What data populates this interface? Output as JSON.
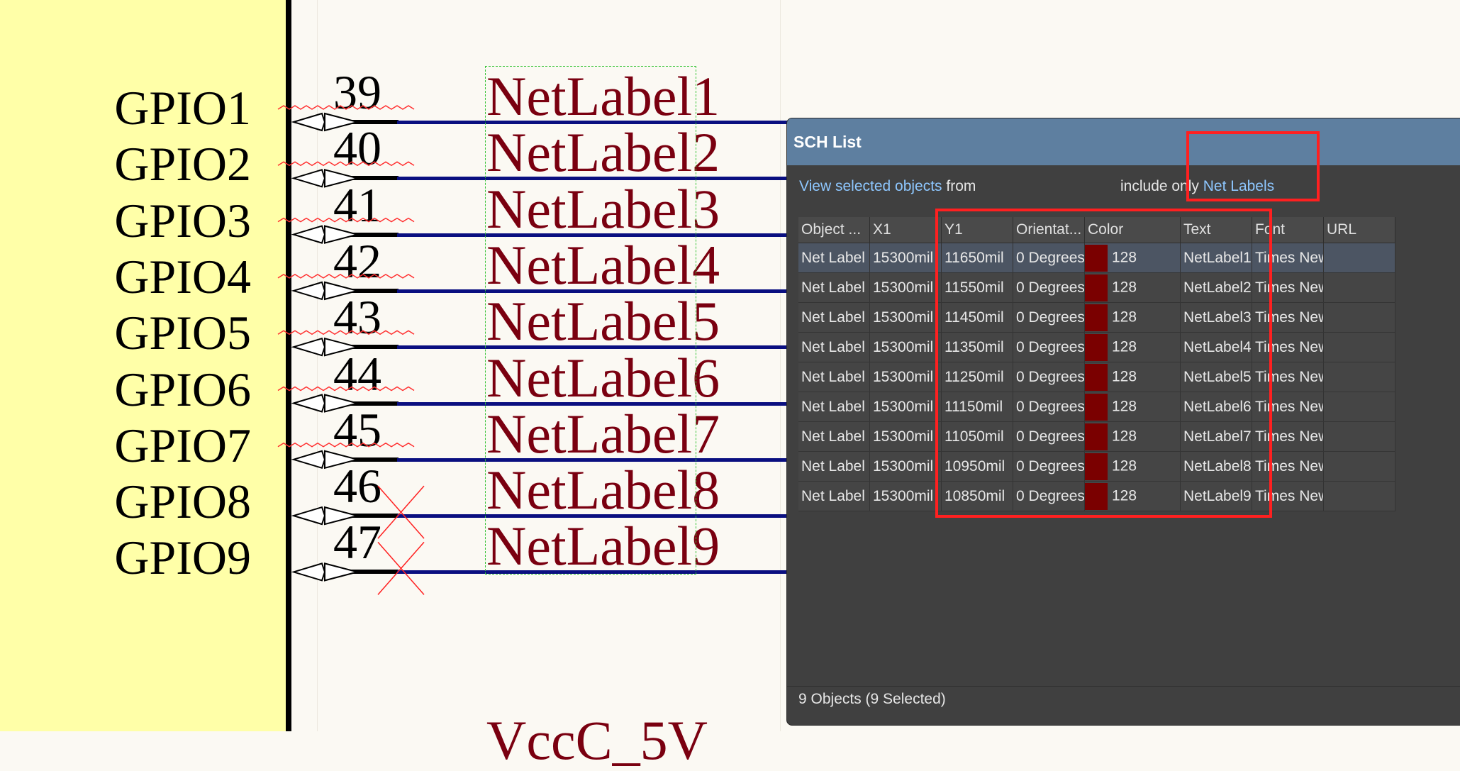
{
  "schematic": {
    "gpio_labels": [
      "GPIO1",
      "GPIO2",
      "GPIO3",
      "GPIO4",
      "GPIO5",
      "GPIO6",
      "GPIO7",
      "GPIO8",
      "GPIO9"
    ],
    "pin_numbers": [
      "39",
      "40",
      "41",
      "42",
      "43",
      "44",
      "45",
      "46",
      "47"
    ],
    "net_labels": [
      "NetLabel1",
      "NetLabel2",
      "NetLabel3",
      "NetLabel4",
      "NetLabel5",
      "NetLabel6",
      "NetLabel7",
      "NetLabel8",
      "NetLabel9"
    ],
    "bottom_text": "VccC_5V"
  },
  "panel": {
    "title": "SCH List",
    "view_link": "View selected objects",
    "from_text": "from",
    "include_text": "include only",
    "include_link": "Net Labels",
    "columns": [
      "Object ...",
      "X1",
      "Y1",
      "Orientat...",
      "Color",
      "Text",
      "Font",
      "URL"
    ],
    "rows": [
      {
        "type": "Net Label",
        "x1": "15300mil",
        "y1": "11650mil",
        "orient": "0 Degrees",
        "color_hex": "#7a0000",
        "color": "128",
        "text": "NetLabel1",
        "font": "Times New Roman",
        "url": ""
      },
      {
        "type": "Net Label",
        "x1": "15300mil",
        "y1": "11550mil",
        "orient": "0 Degrees",
        "color_hex": "#7a0000",
        "color": "128",
        "text": "NetLabel2",
        "font": "Times New Roman",
        "url": ""
      },
      {
        "type": "Net Label",
        "x1": "15300mil",
        "y1": "11450mil",
        "orient": "0 Degrees",
        "color_hex": "#7a0000",
        "color": "128",
        "text": "NetLabel3",
        "font": "Times New Roman",
        "url": ""
      },
      {
        "type": "Net Label",
        "x1": "15300mil",
        "y1": "11350mil",
        "orient": "0 Degrees",
        "color_hex": "#7a0000",
        "color": "128",
        "text": "NetLabel4",
        "font": "Times New Roman",
        "url": ""
      },
      {
        "type": "Net Label",
        "x1": "15300mil",
        "y1": "11250mil",
        "orient": "0 Degrees",
        "color_hex": "#7a0000",
        "color": "128",
        "text": "NetLabel5",
        "font": "Times New Roman",
        "url": ""
      },
      {
        "type": "Net Label",
        "x1": "15300mil",
        "y1": "11150mil",
        "orient": "0 Degrees",
        "color_hex": "#7a0000",
        "color": "128",
        "text": "NetLabel6",
        "font": "Times New Roman",
        "url": ""
      },
      {
        "type": "Net Label",
        "x1": "15300mil",
        "y1": "11050mil",
        "orient": "0 Degrees",
        "color_hex": "#7a0000",
        "color": "128",
        "text": "NetLabel7",
        "font": "Times New Roman",
        "url": ""
      },
      {
        "type": "Net Label",
        "x1": "15300mil",
        "y1": "10950mil",
        "orient": "0 Degrees",
        "color_hex": "#7a0000",
        "color": "128",
        "text": "NetLabel8",
        "font": "Times New Roman",
        "url": ""
      },
      {
        "type": "Net Label",
        "x1": "15300mil",
        "y1": "10850mil",
        "orient": "0 Degrees",
        "color_hex": "#7a0000",
        "color": "128",
        "text": "NetLabel9",
        "font": "Times New Roman",
        "url": ""
      }
    ],
    "status": "9 Objects (9 Selected)"
  },
  "colors": {
    "component_body": "#ffffa8",
    "wire": "#0a0f80",
    "netlabel_text": "#7a0010",
    "panel_title_bar": "#5e7fa0",
    "highlight": "#ff2020"
  }
}
